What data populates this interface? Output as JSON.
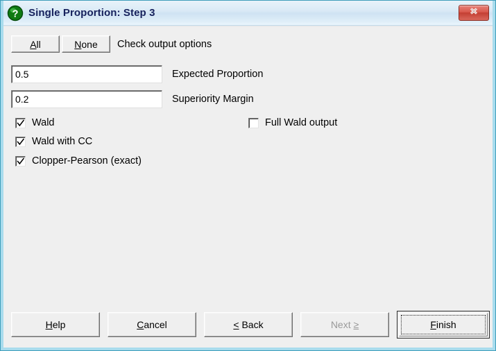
{
  "window": {
    "title": "Single Proportion: Step 3",
    "icon": "question-mark-icon",
    "close_label": "X",
    "accent_title_color": "#16215c",
    "close_button_color": "#c33f33",
    "border_color": "#a9dced"
  },
  "toolbar": {
    "all_label": "All",
    "all_accel": "A",
    "none_label": "None",
    "none_accel": "N",
    "hint": "Check output options"
  },
  "fields": [
    {
      "value": "0.5",
      "label": "Expected Proportion",
      "placeholder": ""
    },
    {
      "value": "0.2",
      "label": "Superiority Margin",
      "placeholder": ""
    }
  ],
  "checkboxes": {
    "left": [
      {
        "label": "Wald",
        "checked": true
      },
      {
        "label": "Wald with CC",
        "checked": true
      },
      {
        "label": "Clopper-Pearson (exact)",
        "checked": true
      }
    ],
    "right": [
      {
        "label": "Full Wald output",
        "checked": false
      }
    ]
  },
  "footer": {
    "help": {
      "pre": "",
      "accel": "H",
      "post": "elp",
      "disabled": false
    },
    "cancel": {
      "pre": "",
      "accel": "C",
      "post": "ancel",
      "disabled": false
    },
    "back": {
      "pre": "",
      "accel": "<",
      "post": " Back",
      "disabled": false
    },
    "next": {
      "pre": "Next ",
      "accel": "",
      "post": "≥",
      "disabled": true
    },
    "finish": {
      "pre": "",
      "accel": "F",
      "post": "inish",
      "disabled": false,
      "default": true
    }
  }
}
